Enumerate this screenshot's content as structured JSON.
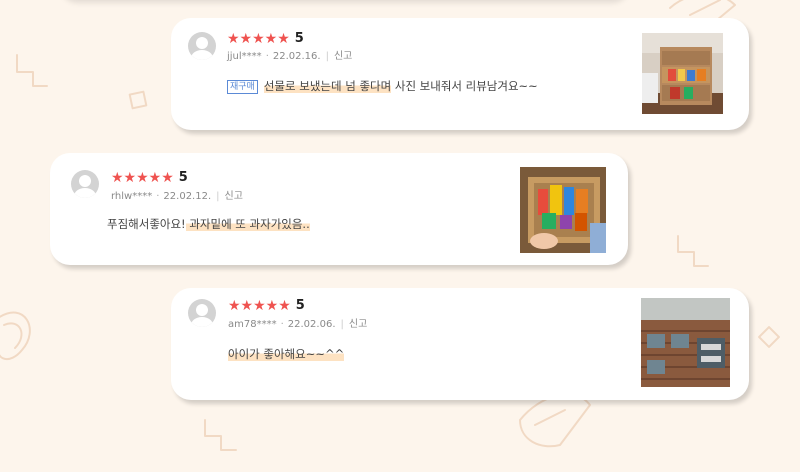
{
  "reviews": [
    {
      "stars": "★★★★★",
      "score": "5",
      "user": "jjul****",
      "date": "22.02.16.",
      "report": "신고",
      "badge": "재구매",
      "text_plain_before": "",
      "text_highlight": "선물로 보냈는데 넘 좋다며",
      "text_plain_after": " 사진 보내줘서 리뷰남겨요~~"
    },
    {
      "stars": "★★★★★",
      "score": "5",
      "user": "rhlw****",
      "date": "22.02.12.",
      "report": "신고",
      "text_plain_before": "푸짐해서좋아요!",
      "text_highlight": " 과자밑에 또 과자가있음..",
      "text_plain_after": ""
    },
    {
      "stars": "★★★★★",
      "score": "5",
      "user": "am78****",
      "date": "22.02.06.",
      "report": "신고",
      "text_plain_before": "",
      "text_highlight": "아이가 좋아해요~~^^",
      "text_plain_after": ""
    }
  ],
  "colors": {
    "background": "#fdf5ec",
    "star": "#ef5350",
    "highlight": "#fde2c2",
    "badge": "#5b8ad6"
  },
  "icons": [
    "user-avatar-icon",
    "star-icon",
    "review-photo"
  ]
}
